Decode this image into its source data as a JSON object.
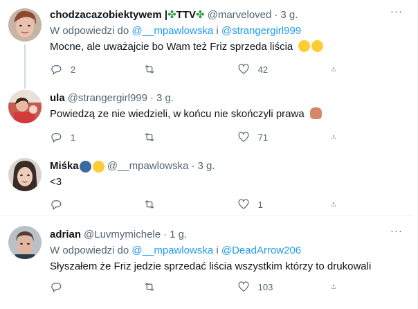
{
  "tweets": [
    {
      "name": "chodzacazobiektywem | ",
      "name_suffix": " TTV ",
      "clover": "✤",
      "handle": "@marveloved",
      "dot": "·",
      "time": "3 g.",
      "reply_prefix": "W odpowiedzi do ",
      "reply_user1": "@__mpawlowska",
      "reply_and": " i ",
      "reply_user2": "@strangergirl999",
      "text": "Mocne, ale uważajcie bo Wam też Friz sprzeda liścia",
      "replies": "2",
      "retweets": "",
      "likes": "42"
    },
    {
      "name": "ula",
      "handle": "@strangergirl999",
      "dot": "·",
      "time": "3 g.",
      "text": "Powiedzą ze nie wiedzieli, w końcu nie skończyli prawa",
      "replies": "1",
      "retweets": "",
      "likes": "71"
    },
    {
      "name": "Miśka",
      "handle": "@__mpawlowska",
      "dot": "·",
      "time": "3 g.",
      "text": "<3",
      "replies": "",
      "retweets": "",
      "likes": "1"
    },
    {
      "name": "adrian",
      "handle": "@Luvmymichele",
      "dot": "·",
      "time": "1 g.",
      "reply_prefix": "W odpowiedzi do ",
      "reply_user1": "@__mpawlowska",
      "reply_and": " i ",
      "reply_user2": "@DeadArrow206",
      "text": "Słyszałem że Friz jedzie sprzedać liścia wszystkim którzy to drukowali",
      "replies": "",
      "retweets": "",
      "likes": "103"
    }
  ],
  "more_label": "···",
  "icons": {
    "reply": "reply-icon",
    "retweet": "retweet-icon",
    "like": "heart-icon",
    "share": "share-icon",
    "more": "more-icon"
  },
  "colors": {
    "link": "#1d9bf0",
    "secondary": "#536471",
    "divider": "#eff3f4",
    "clover": "#2e9e45"
  }
}
